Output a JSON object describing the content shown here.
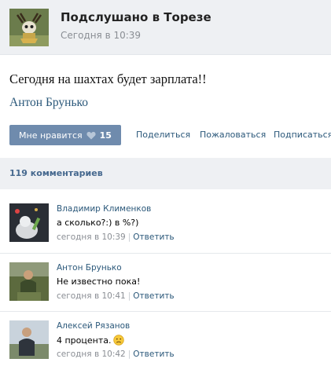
{
  "post": {
    "group_name": "Подслушано в Торезе",
    "time": "Сегодня в 10:39",
    "text": "Сегодня на шахтах будет зарплата!!",
    "author": "Антон Брунько",
    "like_label": "Мне нравится",
    "like_count": "15",
    "actions": [
      "Поделиться",
      "Пожаловаться",
      "Подписаться"
    ]
  },
  "comments_header": "119 комментариев",
  "comments": [
    {
      "author": "Владимир Клименков",
      "text": "а сколько?:) в %?)",
      "time": "сегодня в 10:39",
      "reply": "Ответить"
    },
    {
      "author": "Антон Брунько",
      "text": "Не известно пока!",
      "time": "сегодня в 10:41",
      "reply": "Ответить"
    },
    {
      "author": "Алексей Рязанов",
      "text": "4 процента.",
      "time": "сегодня в 10:42",
      "reply": "Ответить",
      "emoji": "sad-face-icon"
    }
  ],
  "colors": {
    "link": "#2b587a",
    "like_button": "#6f8bad",
    "header_bg": "#eef0f3",
    "muted": "#8a8e94"
  }
}
